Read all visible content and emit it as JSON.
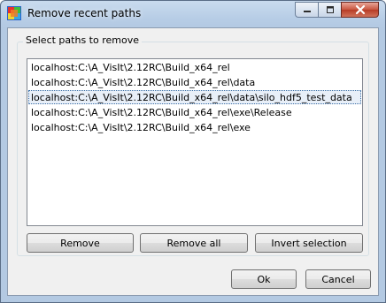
{
  "window": {
    "title": "Remove recent paths",
    "controls": [
      "minimize-icon",
      "maximize-icon",
      "close-icon"
    ]
  },
  "group": {
    "label": "Select paths to remove"
  },
  "paths": [
    "localhost:C:\\A_VisIt\\2.12RC\\Build_x64_rel",
    "localhost:C:\\A_VisIt\\2.12RC\\Build_x64_rel\\data",
    "localhost:C:\\A_VisIt\\2.12RC\\Build_x64_rel\\data\\silo_hdf5_test_data",
    "localhost:C:\\A_VisIt\\2.12RC\\Build_x64_rel\\exe\\Release",
    "localhost:C:\\A_VisIt\\2.12RC\\Build_x64_rel\\exe"
  ],
  "selected_path_index": 2,
  "actions": {
    "remove": "Remove",
    "remove_all": "Remove all",
    "invert_selection": "Invert selection"
  },
  "dialog_buttons": {
    "ok": "Ok",
    "cancel": "Cancel"
  },
  "colors": {
    "selection_border": "#3a6ea5",
    "window_frame": "#b7cde6",
    "close_button": "#c8553f"
  }
}
